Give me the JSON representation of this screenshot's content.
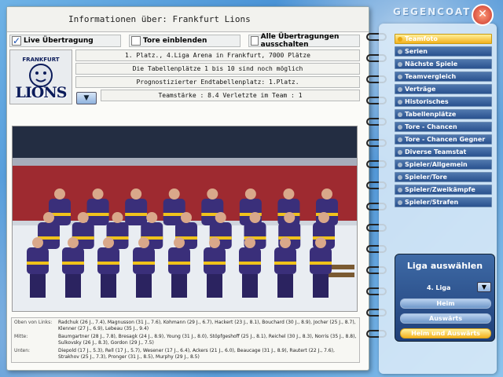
{
  "header": {
    "title": "Informationen über: Frankfurt Lions"
  },
  "options": {
    "live": "Live Übertragung",
    "tore": "Tore einblenden",
    "alle": "Alle Übertragungen ausschalten"
  },
  "team": {
    "logo_text": "LIONS",
    "line1": "1. Platz., 4.Liga      Arena in Frankfurt, 7000 Plätze",
    "line2": "Die Tabellenplätze 1 bis 10 sind noch möglich",
    "line3": "Prognostizierter Endtabellenplatz: 1.Platz.",
    "line4": "Teamstärke : 8.4      Verletzte im Team : 1"
  },
  "caption": {
    "rows": [
      {
        "label": "Oben von Links:",
        "text": "Radchuk (26 J., 7.4), Magnusson (31 J., 7.6), Kohmann (29 J., 6.7), Hackert (23 J., 8.1), Bouchard (30 J., 8.9), Jocher (25 J., 8.7), Klenner (27 J., 6.9), Lebeau (35 J., 9.4)"
      },
      {
        "label": "Mitte:",
        "text": "Baumgartner (28 J., 7.8), Bresagk (24 J., 8.9), Young (31 J., 8.0), Stöpfgeshoff (25 J., 8.1), Reichel (30 J., 8.3), Norris (35 J., 8.8), Sulkovsky (26 J., 8.3), Gordon (29 J., 7.5)"
      },
      {
        "label": "Unten:",
        "text": "Diepold (17 J., 5.3), Rell (17 J., 5.7), Wesener (17 J., 6.4), Ackers (21 J., 6.0), Beaucage (31 J., 8.9), Rautert (22 J., 7.6), Strakhov (25 J., 7.3), Pronger (31 J., 8.5), Murphy (29 J., 8.5)"
      }
    ]
  },
  "nav": {
    "logo": "GEGENCOAT",
    "items": [
      "Teamfoto",
      "Serien",
      "Nächste Spiele",
      "Teamvergleich",
      "Verträge",
      "Historisches",
      "Tabellenplätze",
      "Tore - Chancen",
      "Tore - Chancen Gegner",
      "Diverse Teamstat",
      "Spieler/Allgemein",
      "Spieler/Tore",
      "Spieler/Zweikämpfe",
      "Spieler/Strafen"
    ]
  },
  "liga": {
    "title": "Liga auswählen",
    "value": "4. Liga",
    "btn_heim": "Heim",
    "btn_auswaerts": "Auswärts",
    "btn_both": "Heim und Auswärts"
  }
}
